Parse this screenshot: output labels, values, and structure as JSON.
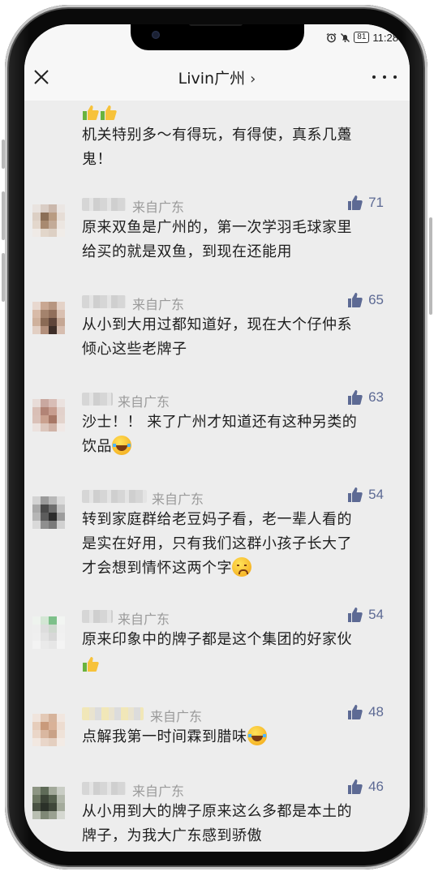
{
  "status_bar": {
    "battery": "81",
    "time": "11:28"
  },
  "header": {
    "title": "Livin广州",
    "chevron": "›"
  },
  "top_comment": {
    "line1": "机关特别多～有得玩，有得使，真系几躉",
    "line2": "鬼！"
  },
  "comments": [
    {
      "location": "来自广东",
      "likes": "71",
      "line1": "原来双鱼是广州的，第一次学羽毛球家里",
      "line2": "给买的就是双鱼，到现在还能用"
    },
    {
      "location": "来自广东",
      "likes": "65",
      "line1": "从小到大用过都知道好，现在大个仔仲系",
      "line2": "倾心这些老牌子"
    },
    {
      "location": "来自广东",
      "likes": "63",
      "line1": "沙士！！ 来了广州才知道还有这种另类的",
      "line2": "饮品"
    },
    {
      "location": "来自广东",
      "likes": "54",
      "line1": "转到家庭群给老豆妈子看，老一辈人看的",
      "line2": "是实在好用，只有我们这群小孩子长大了",
      "line3": "才会想到情怀这两个字"
    },
    {
      "location": "来自广东",
      "likes": "54",
      "line1": "原来印象中的牌子都是这个集团的好家伙"
    },
    {
      "location": "来自广东",
      "likes": "48",
      "line1": "点解我第一时间霖到腊味"
    },
    {
      "location": "来自广东",
      "likes": "46",
      "line1": "从小用到大的牌子原来这么多都是本土的",
      "line2": "牌子，为我大广东感到骄傲"
    }
  ],
  "colors": {
    "like_blue": "#5d6a94",
    "background": "#ededed"
  }
}
